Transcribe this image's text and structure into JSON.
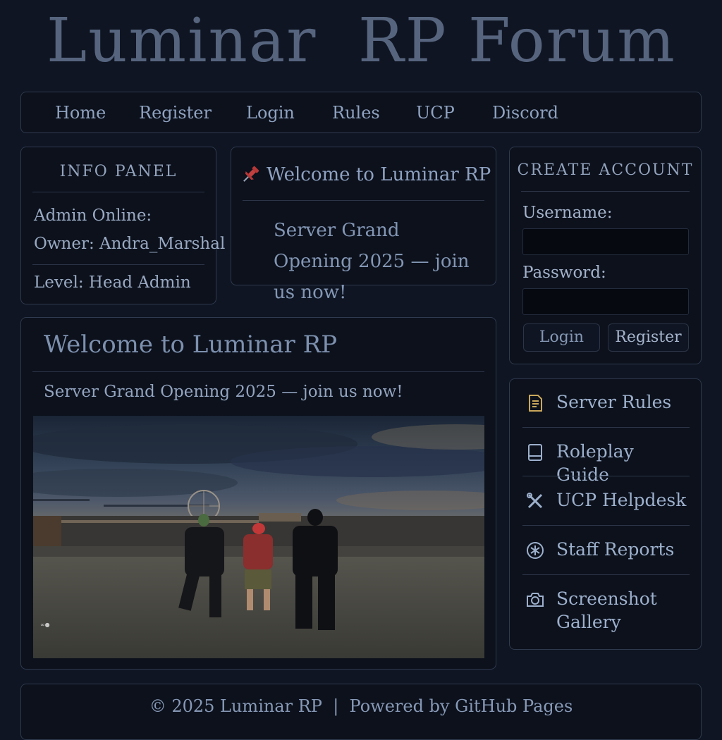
{
  "site": {
    "title": "Luminar  RP Forum"
  },
  "nav": {
    "items": [
      {
        "label": "Home"
      },
      {
        "label": "Register"
      },
      {
        "label": "Login"
      },
      {
        "label": "Rules"
      },
      {
        "label": "UCP"
      },
      {
        "label": "Discord"
      }
    ]
  },
  "info_panel": {
    "heading": "INFO PANEL",
    "admin_online": "Admin Online:",
    "owner": "Owner: Andra_Marshal",
    "level": "Level:  Head Admin"
  },
  "welcome_card": {
    "icon": "pin-icon",
    "title": "Welcome to Luminar RP",
    "message": "Server Grand Opening 2025 — join us now!"
  },
  "main_post": {
    "title": "Welcome to Luminar RP",
    "subtitle": "Server Grand Opening 2025 — join us now!",
    "image": "game-screenshot"
  },
  "create_account": {
    "heading": "CREATE ACCOUNT",
    "username_label": "Username:",
    "username_value": "",
    "password_label": "Password:",
    "password_value": "",
    "login_label": "Login",
    "register_label": "Register"
  },
  "quick_links": [
    {
      "label": "Server Rules",
      "icon": "document-icon"
    },
    {
      "label": "Roleplay Guide",
      "icon": "book-icon"
    },
    {
      "label": "UCP Helpdesk",
      "icon": "tools-icon"
    },
    {
      "label": "Staff Reports",
      "icon": "asterisk-icon"
    },
    {
      "label": "Screenshot Gallery",
      "icon": "camera-icon"
    }
  ],
  "footer": {
    "text": "© 2025 Luminar RP  |  Powered by GitHub Pages"
  },
  "colors": {
    "background": "#0f1522",
    "panel": "#0c111c",
    "border": "#2f3a4f",
    "text": "#a9b8d0",
    "title": "#56647e",
    "icon_accent": "#c9a75a"
  }
}
